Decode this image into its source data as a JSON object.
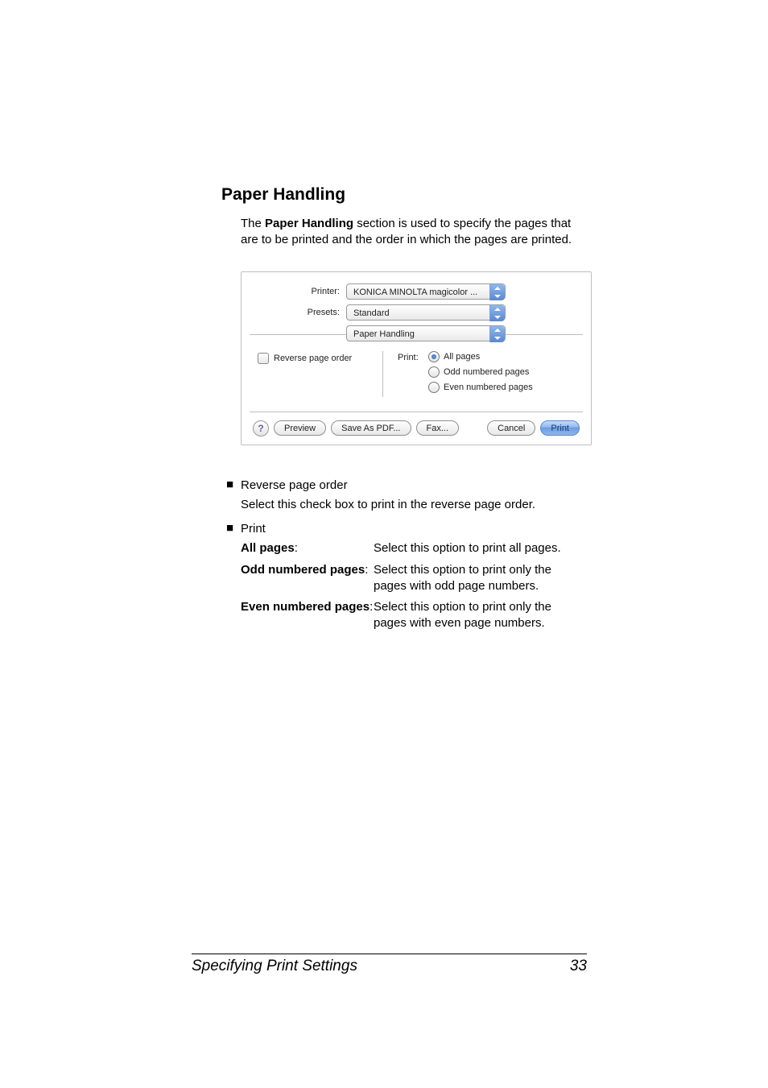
{
  "heading": "Paper Handling",
  "intro_prefix": "The ",
  "intro_bold": "Paper Handling",
  "intro_suffix": " section is used to specify the pages that are to be printed and the order in which the pages are printed.",
  "dialog": {
    "printer_label": "Printer:",
    "printer_value": "KONICA MINOLTA magicolor ...",
    "presets_label": "Presets:",
    "presets_value": "Standard",
    "pane_value": "Paper Handling",
    "reverse_checkbox": "Reverse page order",
    "print_group_label": "Print:",
    "radios": {
      "all": "All pages",
      "odd": "Odd numbered pages",
      "even": "Even numbered pages"
    },
    "help": "?",
    "buttons": {
      "preview": "Preview",
      "save_pdf": "Save As PDF...",
      "fax": "Fax...",
      "cancel": "Cancel",
      "print": "Print"
    }
  },
  "list": {
    "reverse_title": "Reverse page order",
    "reverse_desc": "Select this check box to print in the reverse page order.",
    "print_title": "Print",
    "opts": {
      "all_term": "All pages",
      "all_def": "Select this option to print all pages.",
      "odd_term": "Odd numbered pages",
      "odd_def": "Select this option to print only the pages with odd page numbers.",
      "even_term": "Even numbered pages",
      "even_def": "Select this option to print only the pages with even page numbers."
    }
  },
  "footer": {
    "title": "Specifying Print Settings",
    "page": "33"
  }
}
